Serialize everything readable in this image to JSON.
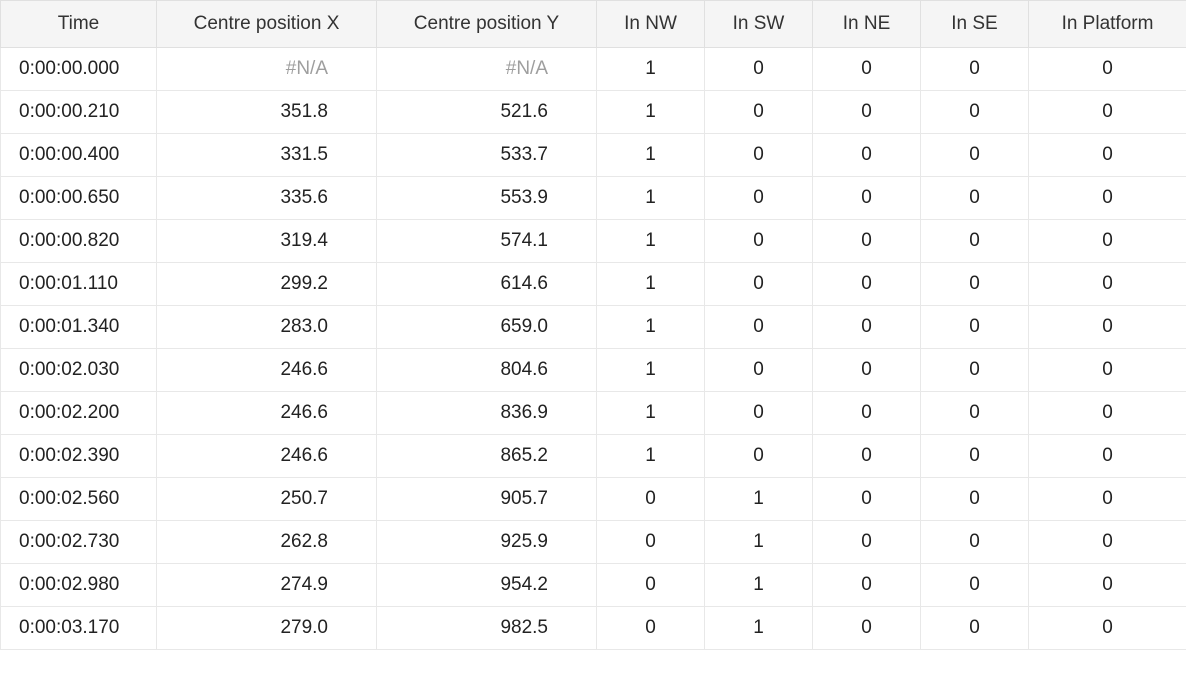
{
  "table": {
    "headers": {
      "time": "Time",
      "posx": "Centre position X",
      "posy": "Centre position Y",
      "nw": "In NW",
      "sw": "In SW",
      "ne": "In NE",
      "se": "In SE",
      "plat": "In Platform"
    },
    "na_label": "#N/A",
    "rows": [
      {
        "time": "0:00:00.000",
        "posx": null,
        "posy": null,
        "nw": "1",
        "sw": "0",
        "ne": "0",
        "se": "0",
        "plat": "0"
      },
      {
        "time": "0:00:00.210",
        "posx": "351.8",
        "posy": "521.6",
        "nw": "1",
        "sw": "0",
        "ne": "0",
        "se": "0",
        "plat": "0"
      },
      {
        "time": "0:00:00.400",
        "posx": "331.5",
        "posy": "533.7",
        "nw": "1",
        "sw": "0",
        "ne": "0",
        "se": "0",
        "plat": "0"
      },
      {
        "time": "0:00:00.650",
        "posx": "335.6",
        "posy": "553.9",
        "nw": "1",
        "sw": "0",
        "ne": "0",
        "se": "0",
        "plat": "0"
      },
      {
        "time": "0:00:00.820",
        "posx": "319.4",
        "posy": "574.1",
        "nw": "1",
        "sw": "0",
        "ne": "0",
        "se": "0",
        "plat": "0"
      },
      {
        "time": "0:00:01.110",
        "posx": "299.2",
        "posy": "614.6",
        "nw": "1",
        "sw": "0",
        "ne": "0",
        "se": "0",
        "plat": "0"
      },
      {
        "time": "0:00:01.340",
        "posx": "283.0",
        "posy": "659.0",
        "nw": "1",
        "sw": "0",
        "ne": "0",
        "se": "0",
        "plat": "0"
      },
      {
        "time": "0:00:02.030",
        "posx": "246.6",
        "posy": "804.6",
        "nw": "1",
        "sw": "0",
        "ne": "0",
        "se": "0",
        "plat": "0"
      },
      {
        "time": "0:00:02.200",
        "posx": "246.6",
        "posy": "836.9",
        "nw": "1",
        "sw": "0",
        "ne": "0",
        "se": "0",
        "plat": "0"
      },
      {
        "time": "0:00:02.390",
        "posx": "246.6",
        "posy": "865.2",
        "nw": "1",
        "sw": "0",
        "ne": "0",
        "se": "0",
        "plat": "0"
      },
      {
        "time": "0:00:02.560",
        "posx": "250.7",
        "posy": "905.7",
        "nw": "0",
        "sw": "1",
        "ne": "0",
        "se": "0",
        "plat": "0"
      },
      {
        "time": "0:00:02.730",
        "posx": "262.8",
        "posy": "925.9",
        "nw": "0",
        "sw": "1",
        "ne": "0",
        "se": "0",
        "plat": "0"
      },
      {
        "time": "0:00:02.980",
        "posx": "274.9",
        "posy": "954.2",
        "nw": "0",
        "sw": "1",
        "ne": "0",
        "se": "0",
        "plat": "0"
      },
      {
        "time": "0:00:03.170",
        "posx": "279.0",
        "posy": "982.5",
        "nw": "0",
        "sw": "1",
        "ne": "0",
        "se": "0",
        "plat": "0"
      }
    ]
  }
}
